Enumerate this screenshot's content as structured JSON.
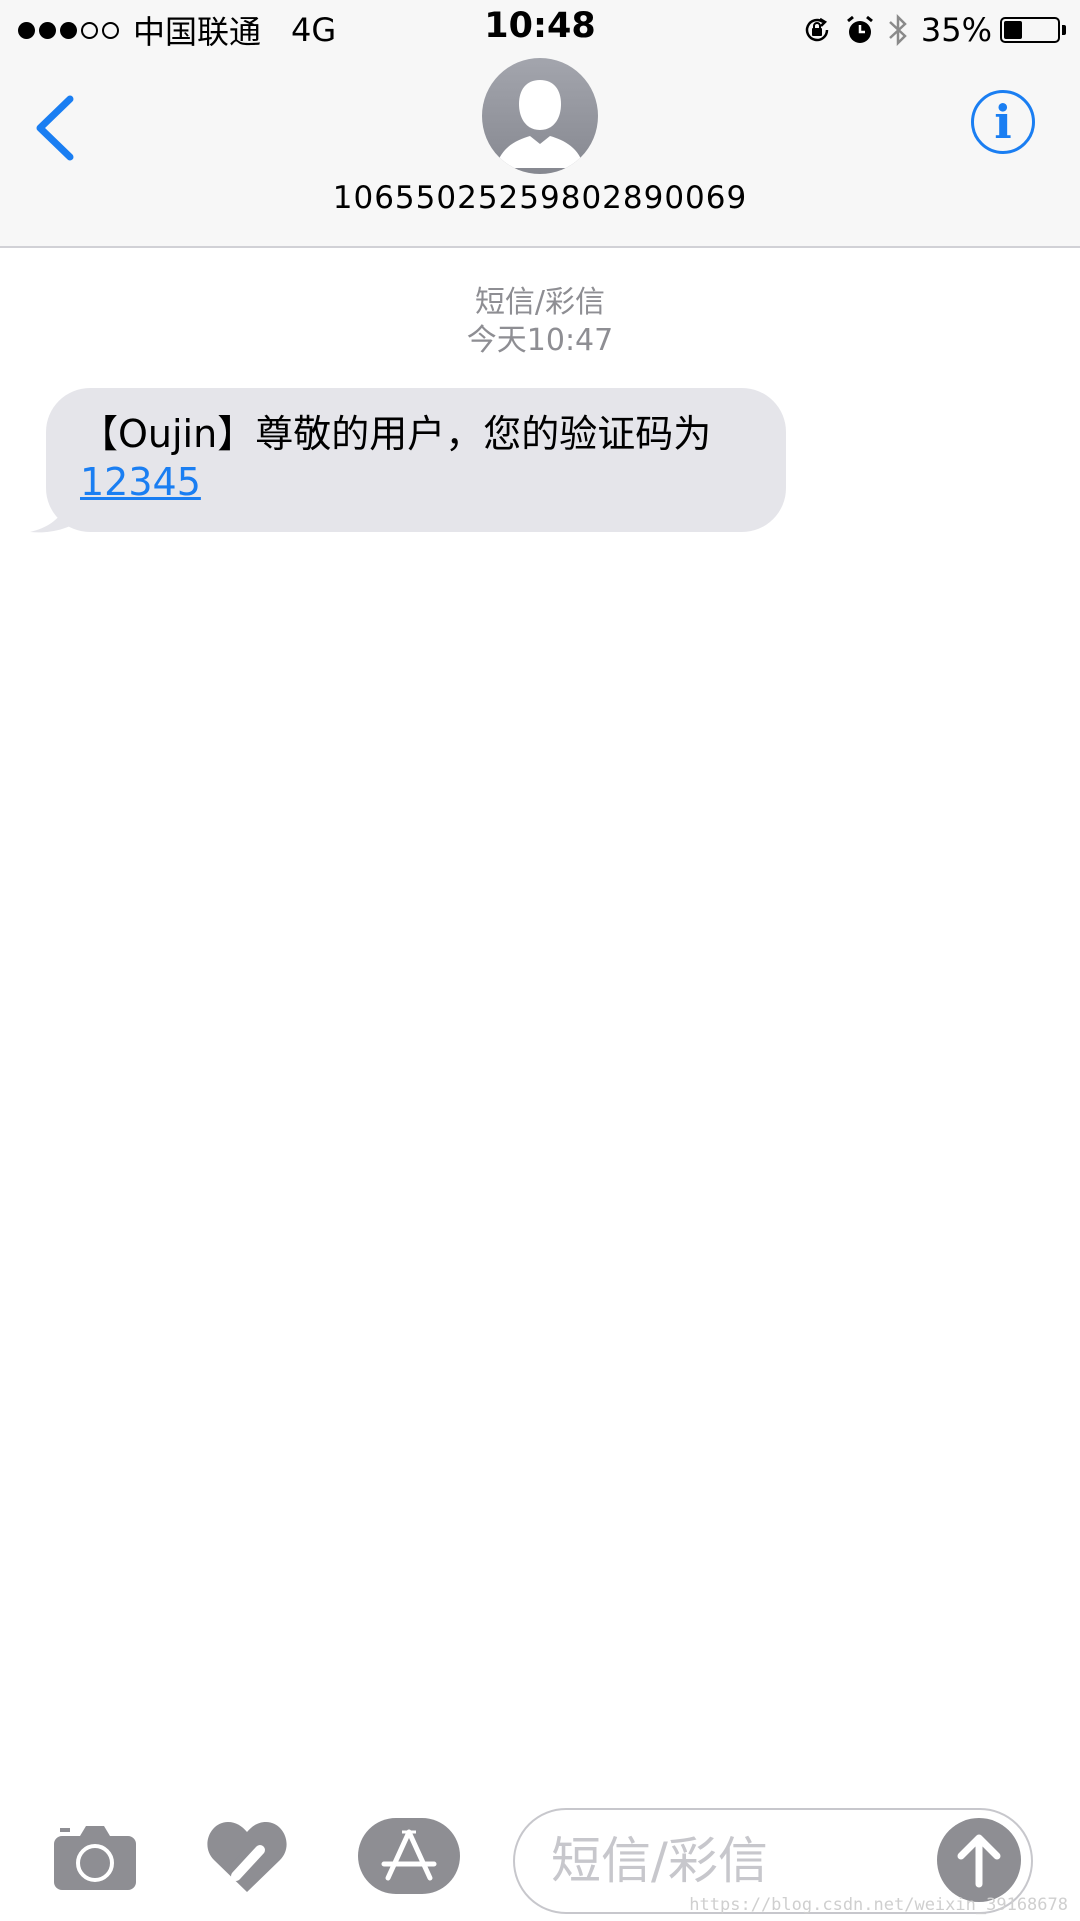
{
  "status_bar": {
    "signal_filled": 3,
    "signal_total": 5,
    "carrier": "中国联通",
    "network": "4G",
    "time": "10:48",
    "battery_text": "35%",
    "battery_level": 0.35,
    "icons": [
      "rotation-lock-icon",
      "alarm-icon",
      "bluetooth-icon",
      "battery-icon"
    ]
  },
  "header": {
    "back_icon": "chevron-left-icon",
    "contact_number": "10655025259802890069",
    "info_label": "i",
    "accent_color": "#1a7ef2"
  },
  "conversation": {
    "type_label": "短信/彩信",
    "timestamp": "今天10:47",
    "messages": [
      {
        "text": "【Oujin】尊敬的用户，您的验证码为",
        "code": "12345"
      }
    ],
    "bubble_color": "#e5e5ea"
  },
  "input_bar": {
    "placeholder": "短信/彩信",
    "tools": [
      "camera-icon",
      "digital-touch-icon",
      "app-store-icon"
    ],
    "send_icon": "arrow-up-icon"
  },
  "watermark": "https://blog.csdn.net/weixin_39168678"
}
